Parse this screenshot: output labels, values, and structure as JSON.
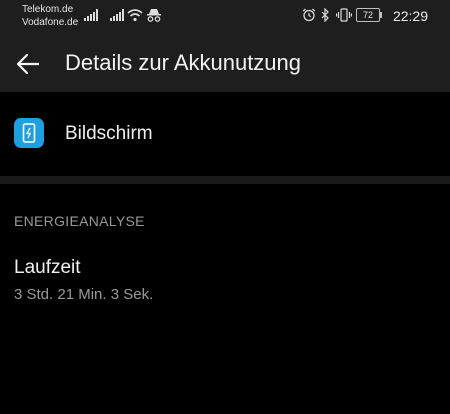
{
  "status_bar": {
    "carriers": [
      "Telekom.de",
      "Vodafone.de"
    ],
    "battery_level": "72",
    "time": "22:29",
    "icons": [
      "signal-icon",
      "signal-icon",
      "wifi-icon",
      "incognito-icon",
      "alarm-icon",
      "bluetooth-icon",
      "vibrate-icon",
      "battery-icon"
    ]
  },
  "header": {
    "back_icon": "arrow-left-icon",
    "title": "Details zur Akkunutzung"
  },
  "app_item": {
    "icon": "screen-icon",
    "icon_color": "#1d9fe0",
    "label": "Bildschirm"
  },
  "section": {
    "header": "ENERGIEANALYSE",
    "rows": [
      {
        "title": "Laufzeit",
        "value": "3 Std. 21 Min. 3 Sek."
      }
    ]
  }
}
